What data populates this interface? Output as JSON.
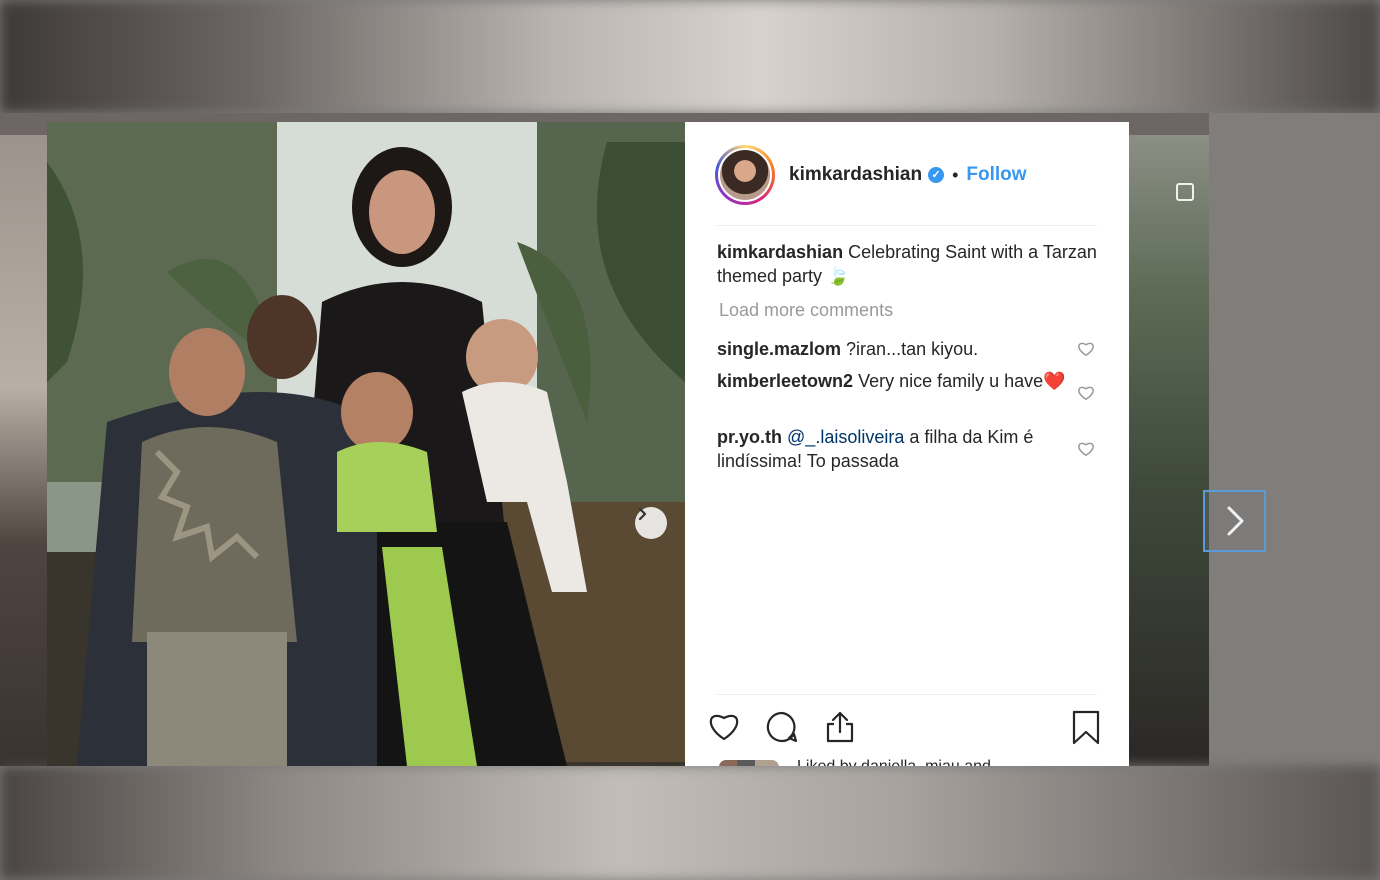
{
  "post": {
    "username": "kimkardashian",
    "verified_badge": "✓",
    "separator": "•",
    "follow_label": "Follow",
    "caption_user": "kimkardashian",
    "caption_text": "Celebrating Saint with a Tarzan themed party 🍃",
    "load_more_label": "Load more comments",
    "liked_by_text": "Liked by daniella_miau and"
  },
  "comments": [
    {
      "user": "single.mazlom",
      "text": "?iran...tan kiyou."
    },
    {
      "user": "kimberleetown2",
      "text": "Very nice family u have❤️"
    },
    {
      "user": "pr.yo.th",
      "mention": "@_.laisoliveira",
      "text": "a filha da Kim é lindíssima! To passada"
    }
  ],
  "icons": {
    "like": "heart-icon",
    "comment": "comment-icon",
    "share": "share-icon",
    "save": "bookmark-icon",
    "next": "chevron-right-icon"
  },
  "colors": {
    "link_blue": "#3897f0",
    "mention_blue": "#003569",
    "muted_gray": "#999999",
    "text": "#262626"
  }
}
